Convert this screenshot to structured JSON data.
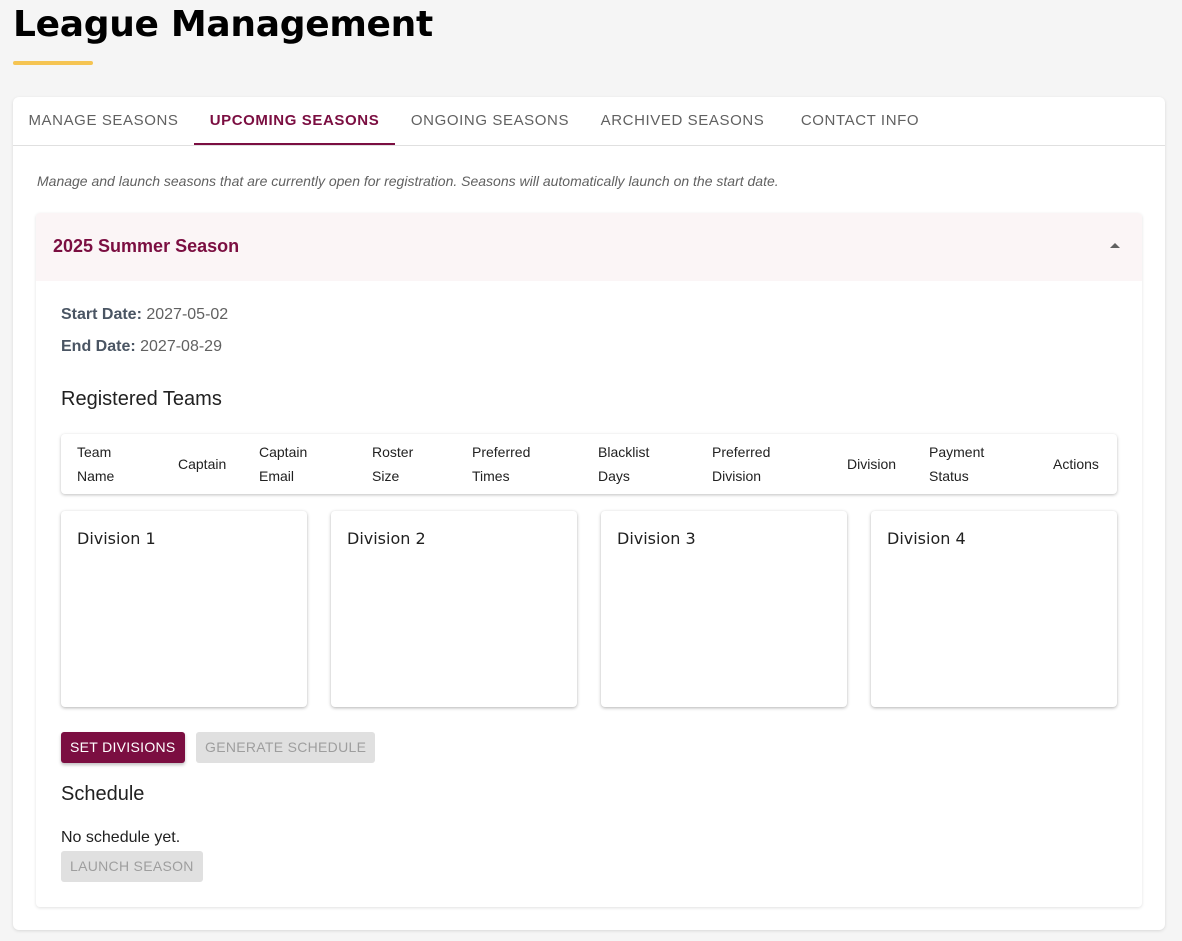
{
  "page": {
    "title": "League Management",
    "accent_color": "#7b0e41",
    "underline_color": "#f5c452"
  },
  "tabs": [
    {
      "label": "MANAGE SEASONS",
      "active": false
    },
    {
      "label": "UPCOMING SEASONS",
      "active": true
    },
    {
      "label": "ONGOING SEASONS",
      "active": false
    },
    {
      "label": "ARCHIVED SEASONS",
      "active": false
    },
    {
      "label": "CONTACT INFO",
      "active": false
    }
  ],
  "intro_text": "Manage and launch seasons that are currently open for registration. Seasons will automatically launch on the start date.",
  "season": {
    "title": "2025 Summer Season",
    "expanded": true,
    "collapse_icon": "caret-up-icon",
    "start_label": "Start Date:",
    "start_value": "2027-05-02",
    "end_label": "End Date:",
    "end_value": "2027-08-29",
    "registered_heading": "Registered Teams",
    "table_columns": [
      [
        "Team",
        "Name"
      ],
      [
        "Captain"
      ],
      [
        "Captain",
        "Email"
      ],
      [
        "Roster",
        "Size"
      ],
      [
        "Preferred",
        "Times"
      ],
      [
        "Blacklist",
        "Days"
      ],
      [
        "Preferred",
        "Division"
      ],
      [
        "Division"
      ],
      [
        "Payment",
        "Status"
      ],
      [
        "Actions"
      ]
    ],
    "divisions": [
      "Division 1",
      "Division 2",
      "Division 3",
      "Division 4"
    ],
    "set_divisions_label": "SET DIVISIONS",
    "generate_schedule_label": "GENERATE SCHEDULE",
    "schedule_heading": "Schedule",
    "no_schedule_text": "No schedule yet.",
    "launch_label": "LAUNCH SEASON"
  }
}
